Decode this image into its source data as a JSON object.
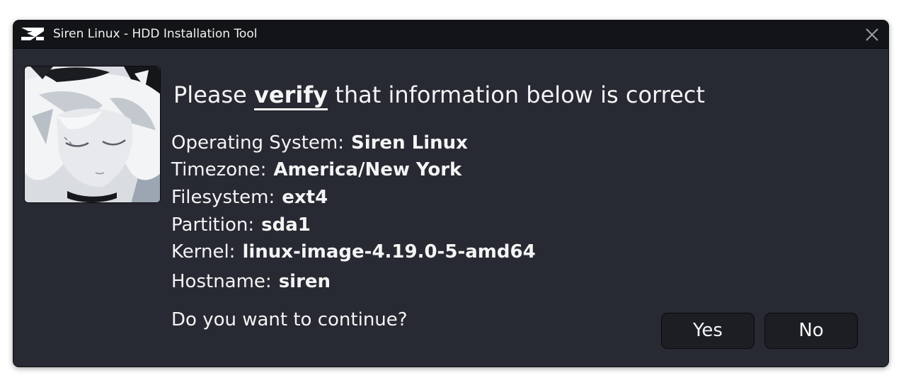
{
  "window": {
    "title": "Siren Linux - HDD Installation Tool"
  },
  "dialog": {
    "heading_prefix": "Please",
    "heading_emphasis": "verify",
    "heading_suffix": "that information below is correct",
    "fields": [
      {
        "label": "Operating System:",
        "value": "Siren Linux"
      },
      {
        "label": "Timezone:",
        "value": "America/New York"
      },
      {
        "label": "Filesystem:",
        "value": "ext4"
      },
      {
        "label": "Partition:",
        "value": "sda1"
      },
      {
        "label": "Kernel:",
        "value": "linux-image-4.19.0-5-amd64"
      },
      {
        "label": "Hostname:",
        "value": "siren"
      }
    ],
    "question": "Do you want to continue?",
    "yes_label": "Yes",
    "no_label": "No"
  },
  "icons": {
    "app_logo": "siren-logo-icon",
    "close": "close-icon"
  },
  "colors": {
    "window_bg": "#272933",
    "titlebar_bg": "#131418",
    "text": "#f4f4f4",
    "button_bg": "#1d1e24"
  }
}
